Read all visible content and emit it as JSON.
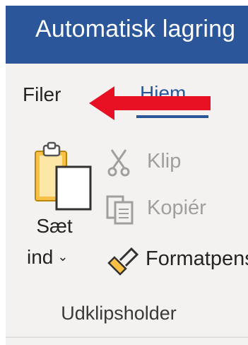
{
  "titlebar": {
    "text": "Automatisk lagring",
    "color": "#2b579a"
  },
  "tabs": [
    {
      "label": "Filer",
      "selected": false
    },
    {
      "label": "Hjem",
      "selected": true
    }
  ],
  "annotation": {
    "type": "arrow",
    "points_to": "Filer",
    "color": "#e81123"
  },
  "ribbon": {
    "clipboard_group": {
      "paste": {
        "label_line1": "Sæt",
        "label_line2": "ind",
        "icon": "clipboard-paste-icon",
        "has_dropdown": true
      },
      "commands": [
        {
          "label": "Klip",
          "icon": "scissors-icon",
          "enabled": false
        },
        {
          "label": "Kopiér",
          "icon": "copy-icon",
          "enabled": false
        },
        {
          "label": "Formatpensel",
          "icon": "format-painter-icon",
          "enabled": true
        }
      ],
      "group_label": "Udklipsholder"
    }
  }
}
